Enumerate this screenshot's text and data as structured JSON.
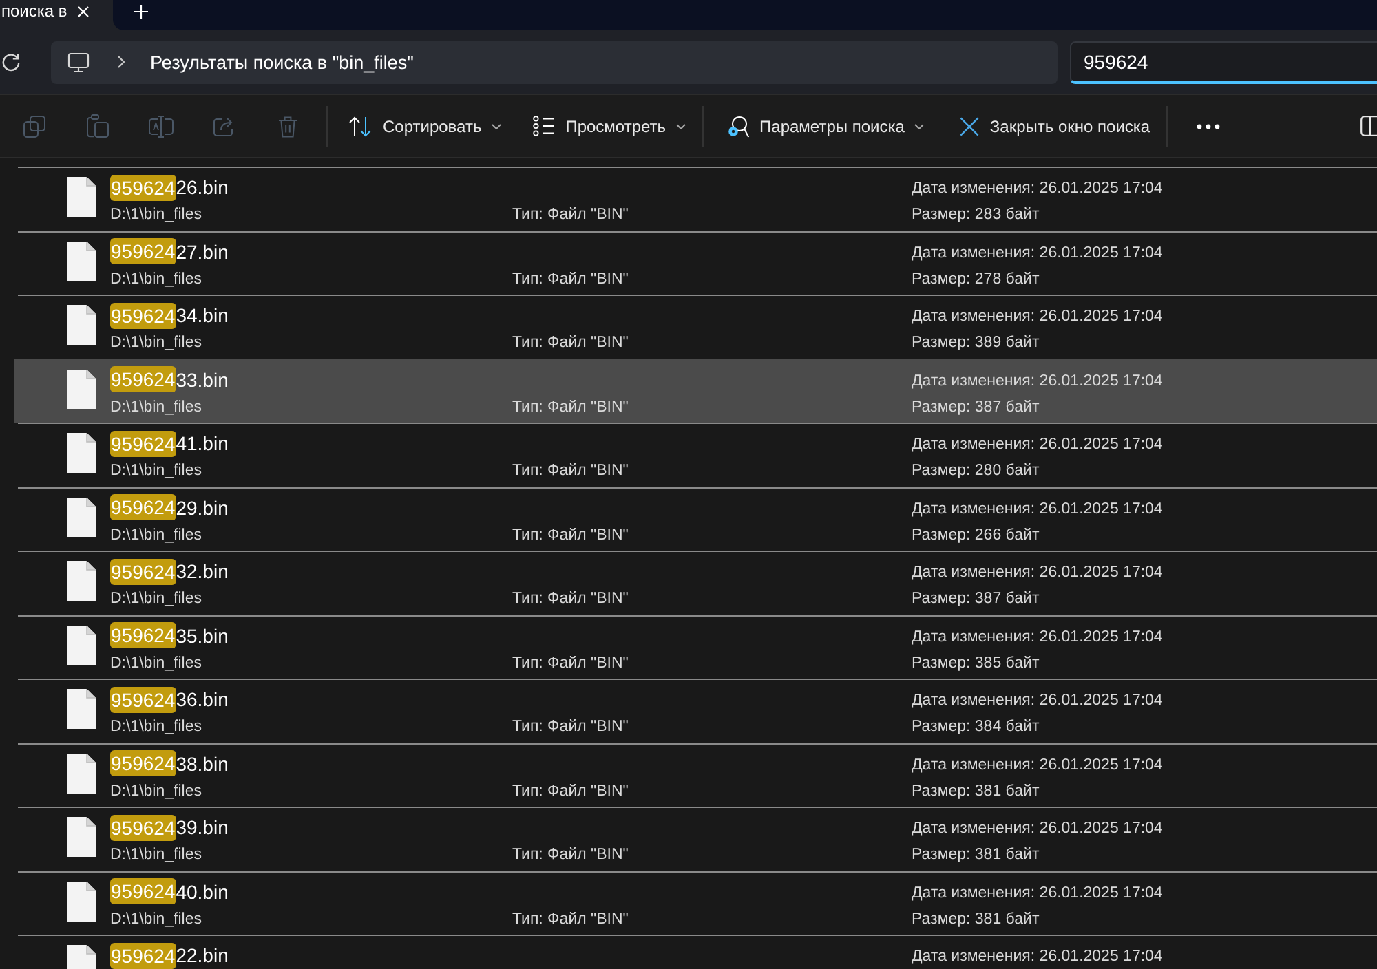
{
  "tabs": [
    {
      "title": "поиска в",
      "selected": true
    }
  ],
  "address_bar": {
    "location": "Результаты поиска в \"bin_files\""
  },
  "search_box": {
    "value": "959624"
  },
  "toolbar": {
    "file_actions": [
      {
        "kind": "copy",
        "disabled": true
      },
      {
        "kind": "paste",
        "disabled": true
      },
      {
        "kind": "rename",
        "disabled": true
      },
      {
        "kind": "share",
        "disabled": true
      },
      {
        "kind": "delete",
        "disabled": true
      }
    ],
    "sort": {
      "label": "Сортировать"
    },
    "view": {
      "label": "Просмотреть"
    },
    "search_options": {
      "label": "Параметры поиска"
    },
    "close_search": {
      "label": "Закрыть окно поиска"
    }
  },
  "results": [
    {
      "name_match": "959624",
      "name_rest": "26.bin",
      "path": "D:\\1\\bin_files",
      "type": "Тип: Файл \"BIN\"",
      "modified": "Дата изменения: 26.01.2025 17:04",
      "size": "Размер: 283 байт",
      "selected": false
    },
    {
      "name_match": "959624",
      "name_rest": "27.bin",
      "path": "D:\\1\\bin_files",
      "type": "Тип: Файл \"BIN\"",
      "modified": "Дата изменения: 26.01.2025 17:04",
      "size": "Размер: 278 байт",
      "selected": false
    },
    {
      "name_match": "959624",
      "name_rest": "34.bin",
      "path": "D:\\1\\bin_files",
      "type": "Тип: Файл \"BIN\"",
      "modified": "Дата изменения: 26.01.2025 17:04",
      "size": "Размер: 389 байт",
      "selected": false
    },
    {
      "name_match": "959624",
      "name_rest": "33.bin",
      "path": "D:\\1\\bin_files",
      "type": "Тип: Файл \"BIN\"",
      "modified": "Дата изменения: 26.01.2025 17:04",
      "size": "Размер: 387 байт",
      "selected": true
    },
    {
      "name_match": "959624",
      "name_rest": "41.bin",
      "path": "D:\\1\\bin_files",
      "type": "Тип: Файл \"BIN\"",
      "modified": "Дата изменения: 26.01.2025 17:04",
      "size": "Размер: 280 байт",
      "selected": false
    },
    {
      "name_match": "959624",
      "name_rest": "29.bin",
      "path": "D:\\1\\bin_files",
      "type": "Тип: Файл \"BIN\"",
      "modified": "Дата изменения: 26.01.2025 17:04",
      "size": "Размер: 266 байт",
      "selected": false
    },
    {
      "name_match": "959624",
      "name_rest": "32.bin",
      "path": "D:\\1\\bin_files",
      "type": "Тип: Файл \"BIN\"",
      "modified": "Дата изменения: 26.01.2025 17:04",
      "size": "Размер: 387 байт",
      "selected": false
    },
    {
      "name_match": "959624",
      "name_rest": "35.bin",
      "path": "D:\\1\\bin_files",
      "type": "Тип: Файл \"BIN\"",
      "modified": "Дата изменения: 26.01.2025 17:04",
      "size": "Размер: 385 байт",
      "selected": false
    },
    {
      "name_match": "959624",
      "name_rest": "36.bin",
      "path": "D:\\1\\bin_files",
      "type": "Тип: Файл \"BIN\"",
      "modified": "Дата изменения: 26.01.2025 17:04",
      "size": "Размер: 384 байт",
      "selected": false
    },
    {
      "name_match": "959624",
      "name_rest": "38.bin",
      "path": "D:\\1\\bin_files",
      "type": "Тип: Файл \"BIN\"",
      "modified": "Дата изменения: 26.01.2025 17:04",
      "size": "Размер: 381 байт",
      "selected": false
    },
    {
      "name_match": "959624",
      "name_rest": "39.bin",
      "path": "D:\\1\\bin_files",
      "type": "Тип: Файл \"BIN\"",
      "modified": "Дата изменения: 26.01.2025 17:04",
      "size": "Размер: 381 байт",
      "selected": false
    },
    {
      "name_match": "959624",
      "name_rest": "40.bin",
      "path": "D:\\1\\bin_files",
      "type": "Тип: Файл \"BIN\"",
      "modified": "Дата изменения: 26.01.2025 17:04",
      "size": "Размер: 381 байт",
      "selected": false
    },
    {
      "name_match": "959624",
      "name_rest": "22.bin",
      "modified": "Дата изменения: 26.01.2025 17:04",
      "selected": false
    }
  ]
}
